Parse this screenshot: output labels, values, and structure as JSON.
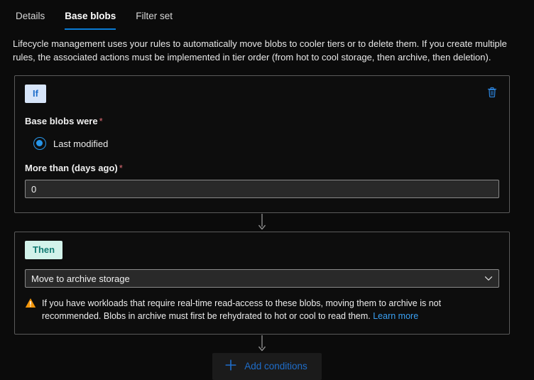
{
  "tabs": [
    {
      "label": "Details",
      "active": false
    },
    {
      "label": "Base blobs",
      "active": true
    },
    {
      "label": "Filter set",
      "active": false
    }
  ],
  "description": "Lifecycle management uses your rules to automatically move blobs to cooler tiers or to delete them. If you create multiple rules, the associated actions must be implemented in tier order (from hot to cool storage, then archive, then deletion).",
  "if_section": {
    "badge": "If",
    "delete_icon": "trash-icon",
    "condition_label": "Base blobs were",
    "required_marker": "*",
    "radio": {
      "label": "Last modified",
      "selected": true
    },
    "days_label": "More than (days ago)",
    "days_required_marker": "*",
    "days_value": "0",
    "days_placeholder": ""
  },
  "then_section": {
    "badge": "Then",
    "action_selected": "Move to archive storage",
    "chevron_icon": "chevron-down-icon",
    "warning": {
      "icon": "warning-triangle-icon",
      "line1": "If you have workloads that require real-time read-access to these blobs, moving them to archive is not recommended.",
      "line2": "Blobs in archive must first be rehydrated to hot or cool to read them.",
      "link_label": "Learn more"
    }
  },
  "add_conditions": {
    "icon": "plus-icon",
    "label": "Add conditions"
  },
  "colors": {
    "accent_blue": "#1f6ecb",
    "tab_underline": "#0a7bd4",
    "if_badge_bg": "#d7e5f9",
    "then_badge_bg": "#d2f2ea",
    "then_badge_fg": "#127a72",
    "warning_orange": "#f2950a",
    "required_red": "#e06c75",
    "link_blue": "#3aa0f3",
    "background": "#0b0b0b"
  }
}
